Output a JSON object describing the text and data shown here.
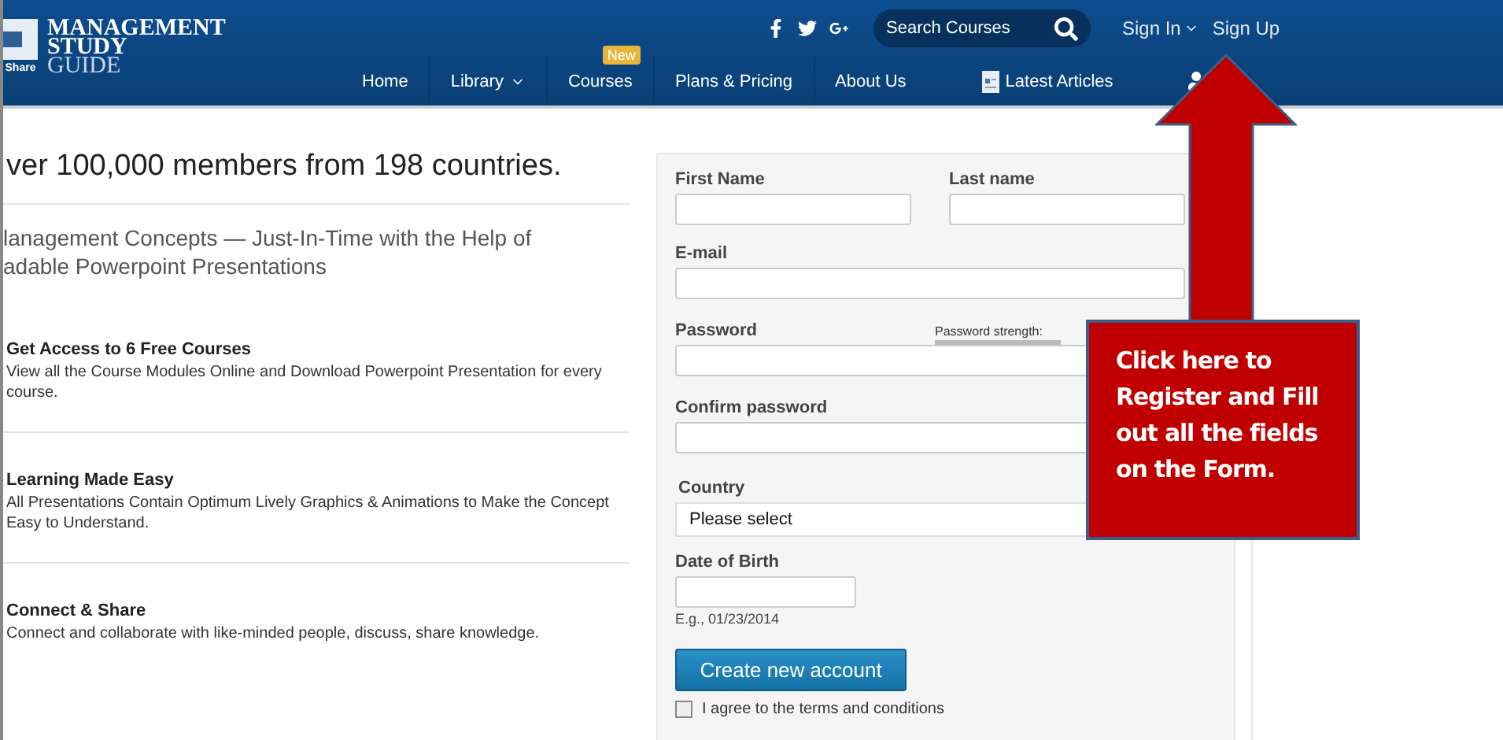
{
  "header": {
    "logo": {
      "lines": [
        "MANAGEMENT",
        "STUDY",
        "GUIDE"
      ],
      "tag": "Share"
    },
    "search": {
      "placeholder": "Search Courses"
    },
    "account": [
      {
        "label": "Sign In",
        "dropdown": true
      },
      {
        "label": "Sign Up",
        "dropdown": false
      }
    ],
    "nav": [
      {
        "kind": "link",
        "label": "Home",
        "dropdown": false
      },
      {
        "kind": "link",
        "label": "Library",
        "dropdown": true
      },
      {
        "kind": "link",
        "label": "Courses",
        "dropdown": false,
        "badge": "New"
      },
      {
        "kind": "link",
        "label": "Plans & Pricing",
        "dropdown": false
      },
      {
        "kind": "link",
        "label": "About Us",
        "dropdown": false
      },
      {
        "kind": "articles",
        "label": "Latest Articles",
        "dropdown": false
      },
      {
        "kind": "people",
        "dropdown": false
      }
    ]
  },
  "intro": {
    "headline": "ver 100,000 members from 198 countries.",
    "subheading": [
      "lanagement Concepts — Just-In-Time with the Help of",
      "adable Powerpoint Presentations"
    ],
    "features": [
      {
        "title": "Get Access to 6 Free Courses",
        "text": "View all the Course Modules Online and Download Powerpoint Presentation for every course."
      },
      {
        "title": "Learning Made Easy",
        "text": "All Presentations Contain Optimum Lively Graphics & Animations to Make the Concept Easy to Understand."
      },
      {
        "title": "Connect & Share",
        "text": "Connect and collaborate with like-minded people, discuss, share knowledge."
      }
    ]
  },
  "form": {
    "first_name": "First Name",
    "last_name": "Last name",
    "email": "E-mail",
    "password": "Password",
    "password_strength": "Password strength:",
    "confirm_password": "Confirm password",
    "country": {
      "label": "Country",
      "value": "Please select"
    },
    "date_of_birth": {
      "label": "Date of Birth",
      "hint": "E.g., 01/23/2014"
    },
    "submit": "Create new account",
    "terms": {
      "label": "I agree to the terms and conditions",
      "checked": false
    }
  },
  "callout": {
    "lines": [
      "Click here to",
      "Register and Fill",
      "out all the fields",
      "on the Form."
    ]
  }
}
